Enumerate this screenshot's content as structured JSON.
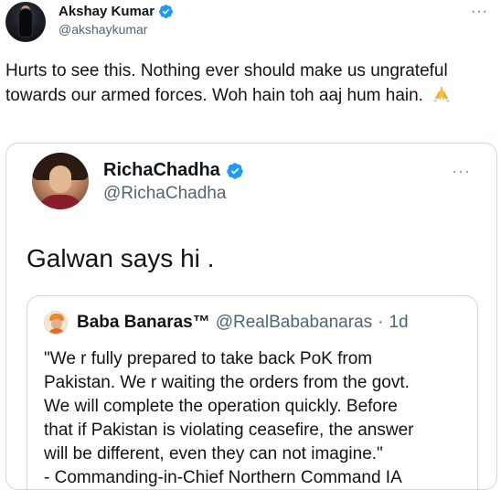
{
  "tweet": {
    "author": {
      "display_name": "Akshay Kumar",
      "handle": "@akshaykumar",
      "avatar_icon": "profile-photo"
    },
    "more_icon": "···",
    "text": "Hurts to see this. Nothing ever should make us ungrateful towards our armed forces. Woh hain toh aaj hum hain.",
    "emoji": "folded-hands"
  },
  "quote": {
    "author": {
      "display_name": "RichaChadha",
      "handle": "@RichaChadha"
    },
    "more_icon": "···",
    "text": "Galwan says hi .",
    "inner_quote": {
      "author_name": "Baba Banaras™",
      "handle": "@RealBababanaras",
      "separator": "·",
      "time": "1d",
      "lines": [
        "\"We r fully prepared to take back PoK from",
        "Pakistan. We r waiting the orders from the govt.",
        "We will complete the operation quickly. Before",
        "that if Pakistan is violating ceasefire, the answer",
        "will be different, even they can not imagine.\"",
        "- Commanding-in-Chief Northern Command IA"
      ]
    }
  },
  "colors": {
    "verified_blue": "#1d9bf0",
    "text_primary": "#0f1419",
    "text_secondary": "#536471",
    "border": "#cfd9de"
  }
}
